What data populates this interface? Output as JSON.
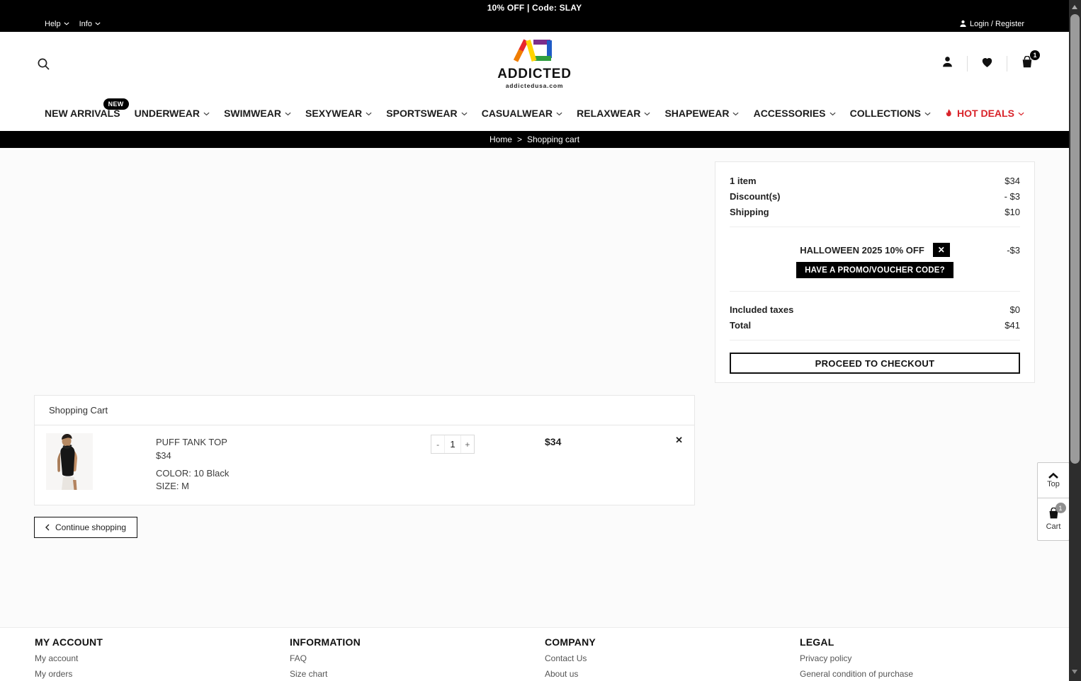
{
  "announcement": {
    "text": "10% OFF | Code: SLAY"
  },
  "topbar": {
    "help": "Help",
    "info": "Info",
    "login": "Login / Register"
  },
  "header": {
    "logo_text": "ADDICTED",
    "logo_sub": "addictedusa.com",
    "cart_count": "1"
  },
  "nav": {
    "items": [
      {
        "label": "NEW ARRIVALS",
        "badge": "NEW"
      },
      {
        "label": "UNDERWEAR",
        "caret": true
      },
      {
        "label": "SWIMWEAR",
        "caret": true
      },
      {
        "label": "SEXYWEAR",
        "caret": true
      },
      {
        "label": "SPORTSWEAR",
        "caret": true
      },
      {
        "label": "CASUALWEAR",
        "caret": true
      },
      {
        "label": "RELAXWEAR",
        "caret": true
      },
      {
        "label": "SHAPEWEAR",
        "caret": true
      },
      {
        "label": "ACCESSORIES",
        "caret": true
      },
      {
        "label": "COLLECTIONS",
        "caret": true
      },
      {
        "label": "HOT DEALS",
        "caret": true,
        "hot": true
      }
    ]
  },
  "breadcrumb": {
    "home": "Home",
    "separator": ">",
    "current": "Shopping cart"
  },
  "summary": {
    "rows": [
      {
        "label": "1 item",
        "value": "$34"
      },
      {
        "label": "Discount(s)",
        "value": "- $3"
      },
      {
        "label": "Shipping",
        "value": "$10"
      }
    ],
    "voucher": {
      "name": "HALLOWEEN 2025 10% OFF",
      "value": "-$3",
      "promo_button": "HAVE A PROMO/VOUCHER CODE?"
    },
    "totals": [
      {
        "label": "Included taxes",
        "value": "$0"
      },
      {
        "label": "Total",
        "value": "$41"
      }
    ],
    "checkout_button": "PROCEED TO CHECKOUT"
  },
  "cart": {
    "title": "Shopping Cart",
    "item": {
      "name": "PUFF TANK TOP",
      "price": "$34",
      "color": "COLOR: 10 Black",
      "size": "SIZE: M",
      "qty": "1",
      "line_price": "$34"
    },
    "continue_shopping": "Continue shopping"
  },
  "floating": {
    "top_label": "Top",
    "cart_label": "Cart",
    "cart_count": "1"
  },
  "footer": {
    "columns": [
      {
        "title": "MY ACCOUNT",
        "links": [
          "My account",
          "My orders"
        ]
      },
      {
        "title": "INFORMATION",
        "links": [
          "FAQ",
          "Size chart"
        ]
      },
      {
        "title": "COMPANY",
        "links": [
          "Contact Us",
          "About us"
        ]
      },
      {
        "title": "LEGAL",
        "links": [
          "Privacy policy",
          "General condition of purchase"
        ]
      }
    ]
  },
  "icons": {
    "close": "✕",
    "minus": "-",
    "plus": "+"
  },
  "colors": {
    "hot_deals_red": "#d9232a",
    "bar_black": "#000000"
  }
}
